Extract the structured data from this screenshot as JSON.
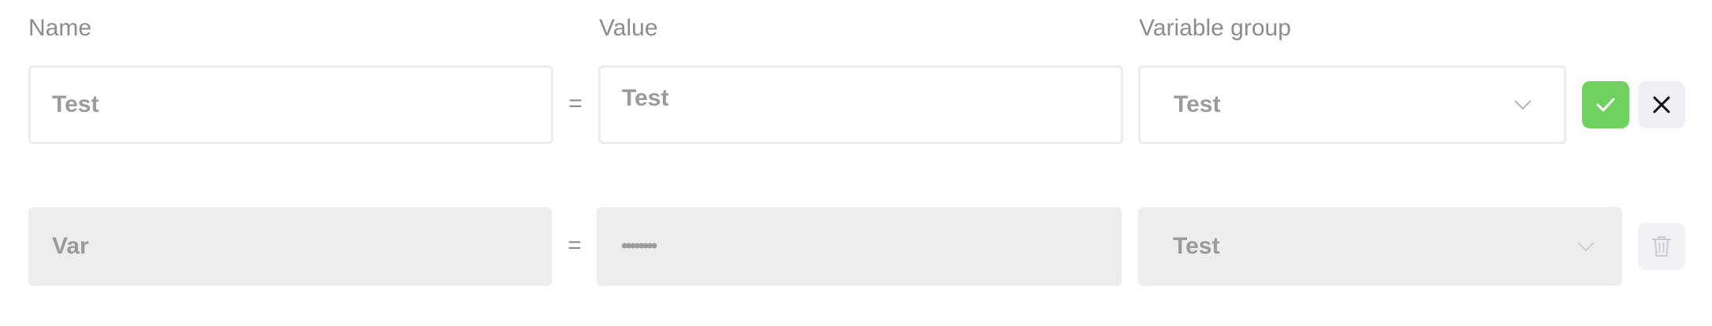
{
  "headers": {
    "name": "Name",
    "value": "Value",
    "variable_group": "Variable group"
  },
  "edit_row": {
    "name_value": "Test",
    "equals": "=",
    "value_value": "Test",
    "group_value": "Test"
  },
  "saved_row": {
    "name_value": "Var",
    "equals": "=",
    "value_masked": "••••••••",
    "group_value": "Test"
  },
  "colors": {
    "confirm_green": "#6fd15e",
    "cancel_bg": "#eef0f5",
    "disabled_bg": "#ededed",
    "text_gray": "#9b9b9b",
    "label_gray": "#8c8c8c"
  },
  "icons": {
    "confirm": "check-icon",
    "cancel": "close-icon",
    "delete": "trash-icon",
    "dropdown": "chevron-down-icon"
  }
}
